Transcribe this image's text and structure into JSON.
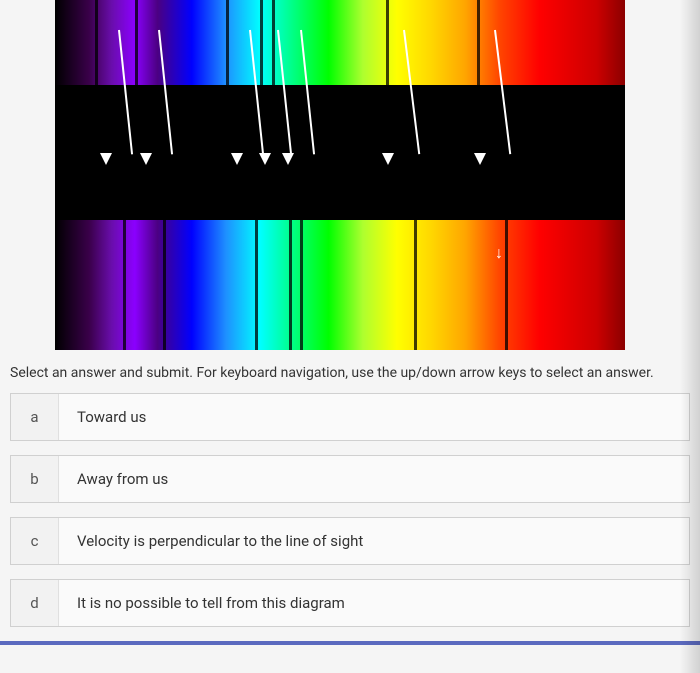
{
  "instructions": "Select an answer and submit. For keyboard navigation, use the up/down arrow keys to select an answer.",
  "answers": [
    {
      "letter": "a",
      "text": "Toward us"
    },
    {
      "letter": "b",
      "text": "Away from us"
    },
    {
      "letter": "c",
      "text": "Velocity is perpendicular to the line of sight"
    },
    {
      "letter": "d",
      "text": "It is no possible to tell from this diagram"
    }
  ],
  "spectrum": {
    "top_lines_pct": [
      7,
      14,
      30,
      36,
      38,
      58,
      74
    ],
    "bottom_lines_pct": [
      12,
      19,
      35,
      41,
      43,
      63,
      79
    ],
    "arrows": [
      {
        "left_pct": 11,
        "rotate_deg": 6
      },
      {
        "left_pct": 18,
        "rotate_deg": 6
      },
      {
        "left_pct": 34,
        "rotate_deg": 6
      },
      {
        "left_pct": 39,
        "rotate_deg": 6
      },
      {
        "left_pct": 43,
        "rotate_deg": 6
      },
      {
        "left_pct": 61,
        "rotate_deg": 7
      },
      {
        "left_pct": 77,
        "rotate_deg": 7
      }
    ]
  }
}
